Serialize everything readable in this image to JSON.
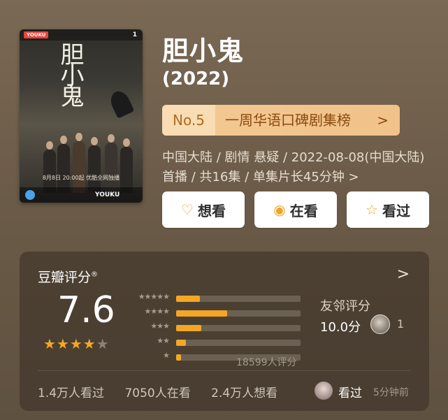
{
  "poster": {
    "title": "胆小鬼",
    "badge": "YOUKU",
    "rank_mark": "1",
    "air_text": "8月8日 20:00起 优酷全网独播",
    "brand": "YOUKU"
  },
  "title": "胆小鬼",
  "year": "(2022)",
  "rank": {
    "number": "No.5",
    "label": "一周华语口碑剧集榜",
    "chevron": ">"
  },
  "meta": "中国大陆 / 剧情 悬疑 / 2022-08-08(中国大陆)首播 / 共16集 / 单集片长45分钟 >",
  "actions": [
    {
      "icon": "♡",
      "label": "想看"
    },
    {
      "icon": "◉",
      "label": "在看"
    },
    {
      "icon": "☆",
      "label": "看过"
    }
  ],
  "rating": {
    "heading": "豆瓣评分",
    "reg": "®",
    "arrow": ">",
    "score": "7.6",
    "stars_on": "★★★★",
    "stars_off": "★",
    "count": "18599人评分",
    "distribution": [
      {
        "stars": "★★★★★",
        "percent": 19
      },
      {
        "stars": "★★★★",
        "percent": 41
      },
      {
        "stars": "★★★",
        "percent": 20
      },
      {
        "stars": "★★",
        "percent": 8
      },
      {
        "stars": "★",
        "percent": 4
      }
    ]
  },
  "friends": {
    "label": "友邻评分",
    "score": "10.0分",
    "count": "1"
  },
  "stats": {
    "watched": "1.4万人看过",
    "watching": "7050人在看",
    "want": "2.4万人想看"
  },
  "recent": {
    "label": "看过",
    "time": "5分钟前"
  }
}
